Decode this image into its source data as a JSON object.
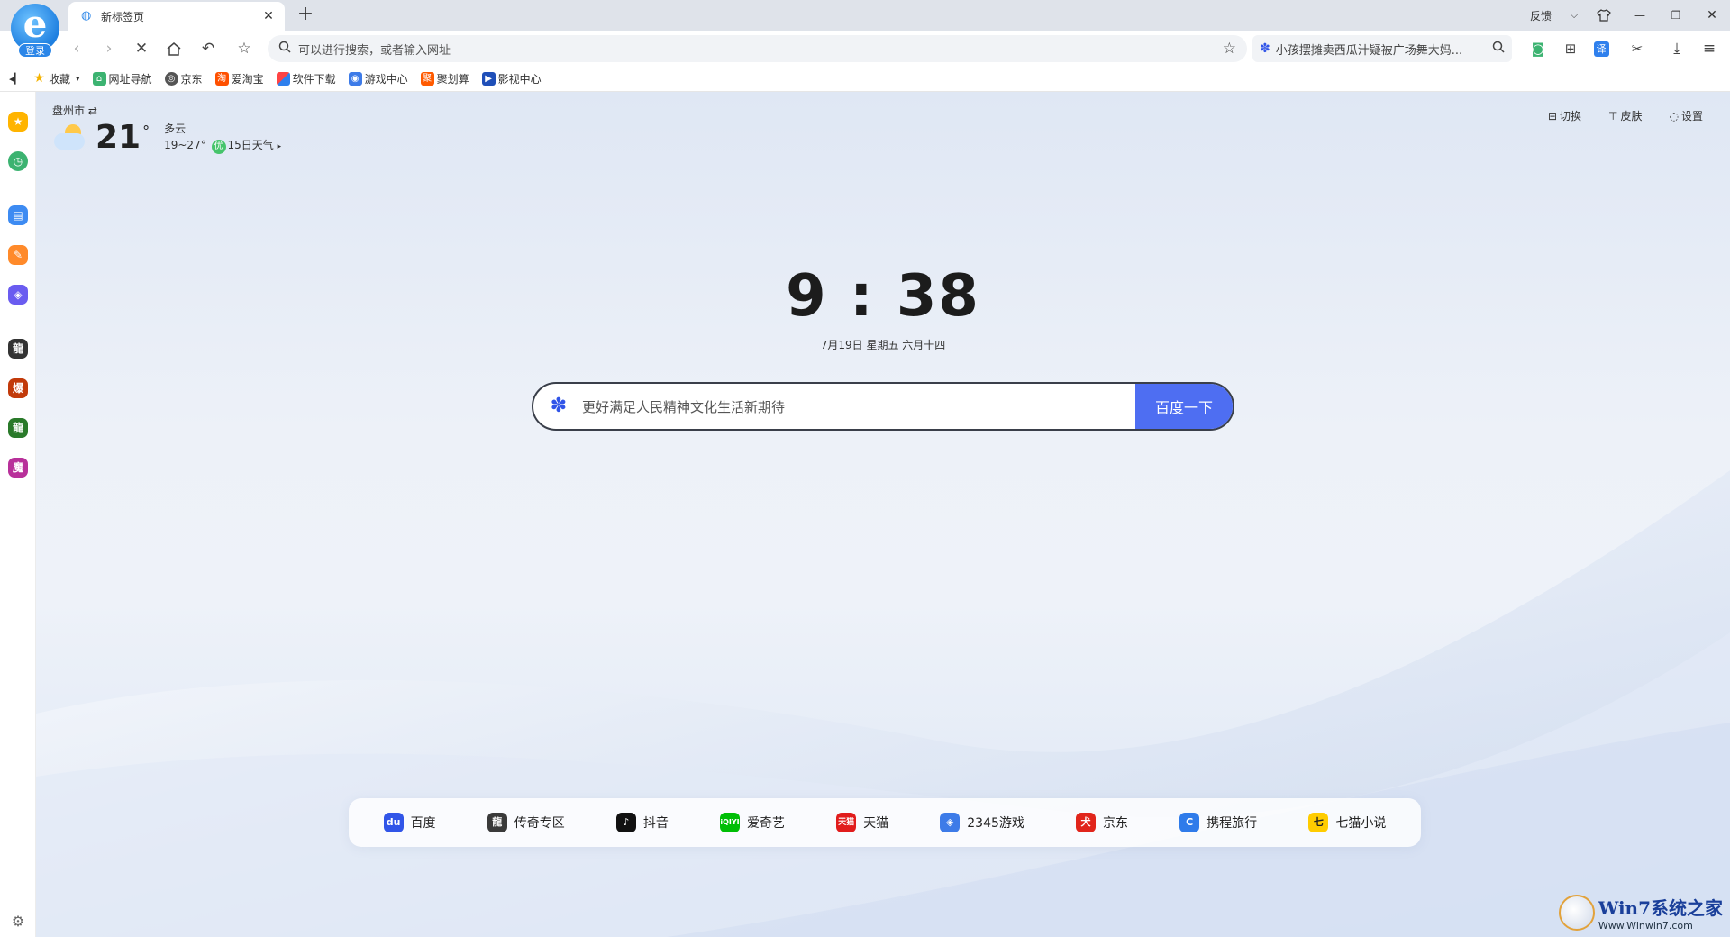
{
  "browser": {
    "login_label": "登录",
    "tab_title": "新标签页",
    "feedback": "反馈"
  },
  "address_bar": {
    "placeholder": "可以进行搜索，或者输入网址",
    "hot_search": "小孩摆摊卖西瓜汁疑被广场舞大妈..."
  },
  "bookmarks": [
    {
      "label": "收藏",
      "color": "#f5b300"
    },
    {
      "label": "网址导航",
      "color": "#3cb371"
    },
    {
      "label": "京东",
      "color": "#555555"
    },
    {
      "label": "爱淘宝",
      "color": "#ff5000"
    },
    {
      "label": "软件下载",
      "color": "#2f80ed"
    },
    {
      "label": "游戏中心",
      "color": "#3d7be8"
    },
    {
      "label": "聚划算",
      "color": "#ff5a00"
    },
    {
      "label": "影视中心",
      "color": "#1f4fb8"
    }
  ],
  "weather": {
    "city": "盘州市",
    "temp": "21",
    "condition": "多云",
    "range": "19~27°",
    "aqi": "优",
    "forecast_link": "15日天气"
  },
  "top_actions": {
    "switch": "切换",
    "skin": "皮肤",
    "settings": "设置"
  },
  "clock": {
    "time": "9 : 38",
    "date": "7月19日  星期五  六月十四"
  },
  "search": {
    "placeholder": "更好满足人民精神文化生活新期待",
    "button": "百度一下"
  },
  "quick_links": [
    {
      "label": "百度",
      "color": "#3155e8",
      "icon": "baidu-icon"
    },
    {
      "label": "传奇专区",
      "color": "#3a3a3a",
      "icon": "legend-icon"
    },
    {
      "label": "抖音",
      "color": "#111111",
      "icon": "douyin-icon"
    },
    {
      "label": "爱奇艺",
      "color": "#00be06",
      "icon": "iqiyi-icon"
    },
    {
      "label": "天猫",
      "color": "#e11c1c",
      "icon": "tmall-icon"
    },
    {
      "label": "2345游戏",
      "color": "#3d7be8",
      "icon": "game-icon"
    },
    {
      "label": "京东",
      "color": "#e1251b",
      "icon": "jd-icon"
    },
    {
      "label": "携程旅行",
      "color": "#2f7bea",
      "icon": "ctrip-icon"
    },
    {
      "label": "七猫小说",
      "color": "#ffcc00",
      "icon": "qimao-icon"
    }
  ],
  "watermark": {
    "title": "Win7系统之家",
    "url": "Www.Winwin7.com"
  }
}
